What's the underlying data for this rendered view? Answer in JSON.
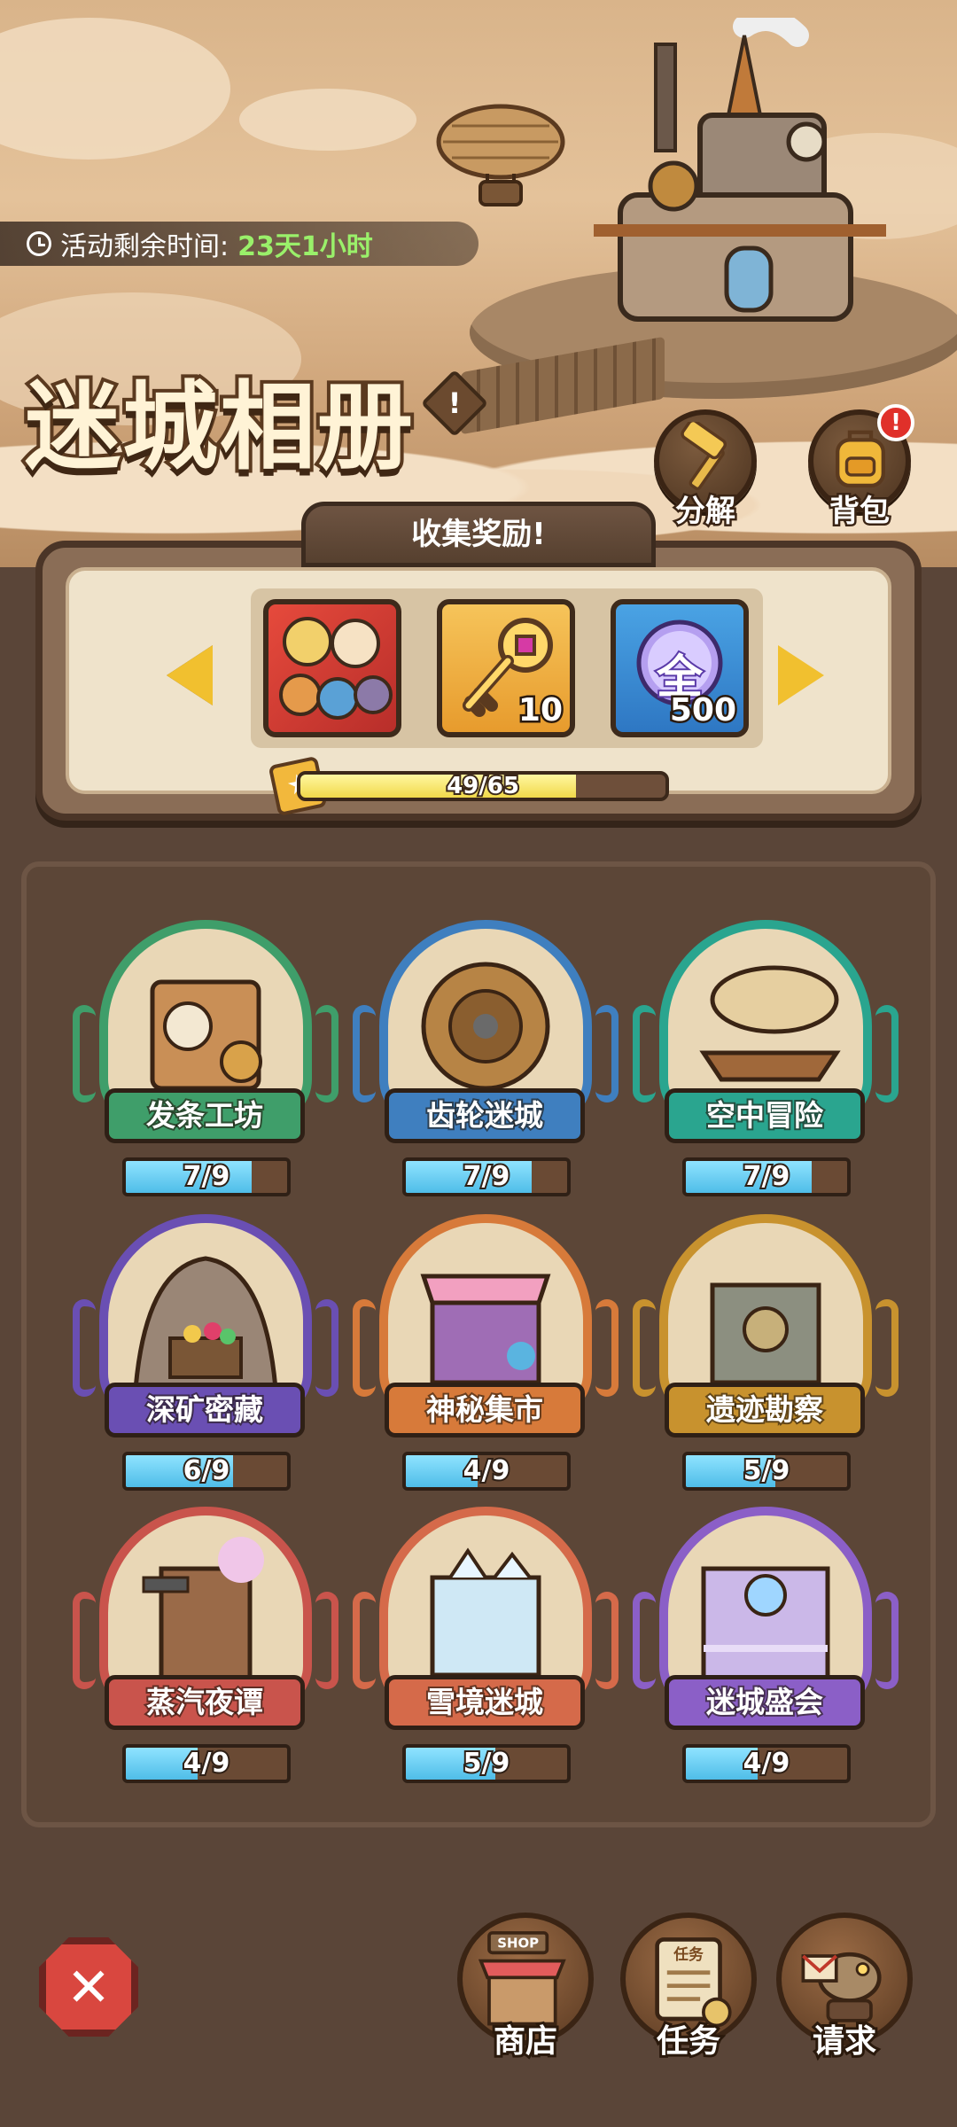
{
  "header": {
    "timer_label": "活动剩余时间:",
    "timer_value": "23天1小时",
    "title": "迷城相册",
    "info_symbol": "!"
  },
  "top_buttons": [
    {
      "label": "分解",
      "icon": "hammer-icon"
    },
    {
      "label": "背包",
      "icon": "backpack-icon",
      "alert": "!"
    }
  ],
  "rewards": {
    "tab_label": "收集奖励!",
    "items": [
      {
        "icon": "character-pack-icon",
        "qty": ""
      },
      {
        "icon": "golden-key-icon",
        "qty": "10"
      },
      {
        "icon": "orb-icon",
        "glyph": "全",
        "qty": "500"
      }
    ],
    "progress_text": "49/65",
    "progress_value": 49,
    "progress_max": 65
  },
  "albums": [
    {
      "name": "发条工坊",
      "progress": "7/9",
      "done": 7,
      "total": 9,
      "theme": "green"
    },
    {
      "name": "齿轮迷城",
      "progress": "7/9",
      "done": 7,
      "total": 9,
      "theme": "blue"
    },
    {
      "name": "空中冒险",
      "progress": "7/9",
      "done": 7,
      "total": 9,
      "theme": "teal"
    },
    {
      "name": "深矿密藏",
      "progress": "6/9",
      "done": 6,
      "total": 9,
      "theme": "purple"
    },
    {
      "name": "神秘集市",
      "progress": "4/9",
      "done": 4,
      "total": 9,
      "theme": "orange"
    },
    {
      "name": "遗迹勘察",
      "progress": "5/9",
      "done": 5,
      "total": 9,
      "theme": "gold"
    },
    {
      "name": "蒸汽夜谭",
      "progress": "4/9",
      "done": 4,
      "total": 9,
      "theme": "red"
    },
    {
      "name": "雪境迷城",
      "progress": "5/9",
      "done": 5,
      "total": 9,
      "theme": "coral"
    },
    {
      "name": "迷城盛会",
      "progress": "4/9",
      "done": 4,
      "total": 9,
      "theme": "violet"
    }
  ],
  "bottom_nav": [
    {
      "label": "商店",
      "icon": "shop-icon",
      "sign": "SHOP"
    },
    {
      "label": "任务",
      "icon": "quest-scroll-icon",
      "sign": "任务"
    },
    {
      "label": "请求",
      "icon": "request-bird-icon"
    }
  ],
  "close": {
    "icon": "close-icon"
  },
  "colors": {
    "green": "#3f9e6a",
    "blue": "#3f7fbf",
    "teal": "#2aa58f",
    "purple": "#6a4fb3",
    "orange": "#d77a3a",
    "gold": "#c8922e",
    "red": "#c9544c",
    "coral": "#d56a4a",
    "violet": "#8b5fc7"
  }
}
